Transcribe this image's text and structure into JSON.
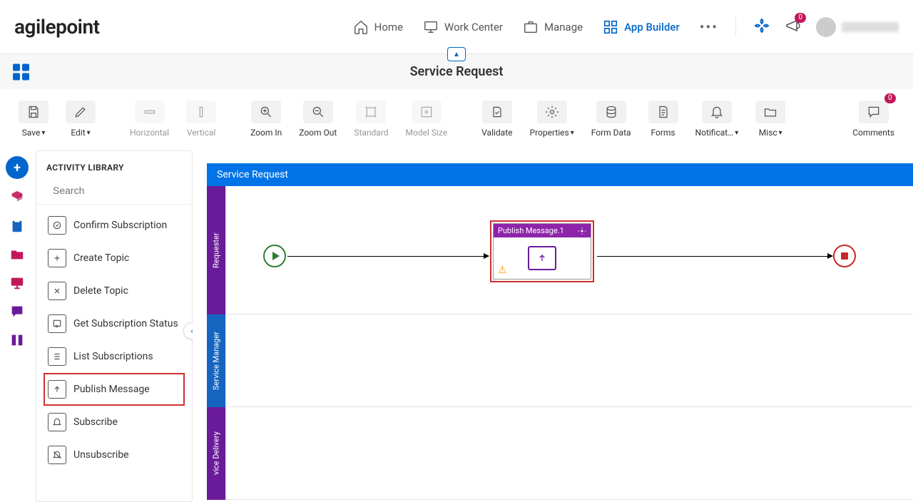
{
  "header": {
    "logo": "agilepoint",
    "nav": {
      "home": "Home",
      "work_center": "Work Center",
      "manage": "Manage",
      "app_builder": "App Builder"
    },
    "notification_badge": "0"
  },
  "subheader": {
    "title": "Service Request"
  },
  "toolbar": {
    "save": "Save",
    "edit": "Edit",
    "horizontal": "Horizontal",
    "vertical": "Vertical",
    "zoom_in": "Zoom In",
    "zoom_out": "Zoom Out",
    "standard": "Standard",
    "model_size": "Model Size",
    "validate": "Validate",
    "properties": "Properties",
    "form_data": "Form Data",
    "forms": "Forms",
    "notifications": "Notificat…",
    "misc": "Misc",
    "comments": "Comments",
    "comments_badge": "0"
  },
  "library": {
    "title": "ACTIVITY LIBRARY",
    "search_placeholder": "Search",
    "items": {
      "confirm_subscription": "Confirm Subscription",
      "create_topic": "Create Topic",
      "delete_topic": "Delete Topic",
      "get_subscription_status": "Get Subscription Status",
      "list_subscriptions": "List Subscriptions",
      "publish_message": "Publish Message",
      "subscribe": "Subscribe",
      "unsubscribe": "Unsubscribe"
    }
  },
  "canvas": {
    "process_title": "Service Request",
    "lanes": {
      "requester": "Requester",
      "service_manager": "Service Manager",
      "service_delivery": "vice Delivery"
    },
    "activity_node": {
      "title": "Publish Message.1"
    }
  }
}
